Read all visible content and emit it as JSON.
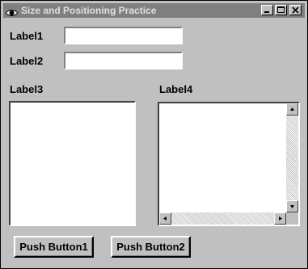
{
  "window": {
    "title": "Size and Positioning Practice"
  },
  "icons": {
    "app": "eye-icon",
    "minimize": "minimize-icon",
    "maximize": "maximize-icon",
    "close": "close-icon",
    "scroll_up": "arrow-up-icon",
    "scroll_down": "arrow-down-icon",
    "scroll_left": "arrow-left-icon",
    "scroll_right": "arrow-right-icon"
  },
  "form": {
    "label1": "Label1",
    "field1_value": "",
    "label2": "Label2",
    "field2_value": "",
    "label3": "Label3",
    "label4": "Label4"
  },
  "buttons": {
    "push1": "Push Button1",
    "push2": "Push Button2"
  },
  "colors": {
    "face": "#c0c0c0",
    "titlebar_inactive": "#808080",
    "field_background": "#ffffff"
  }
}
